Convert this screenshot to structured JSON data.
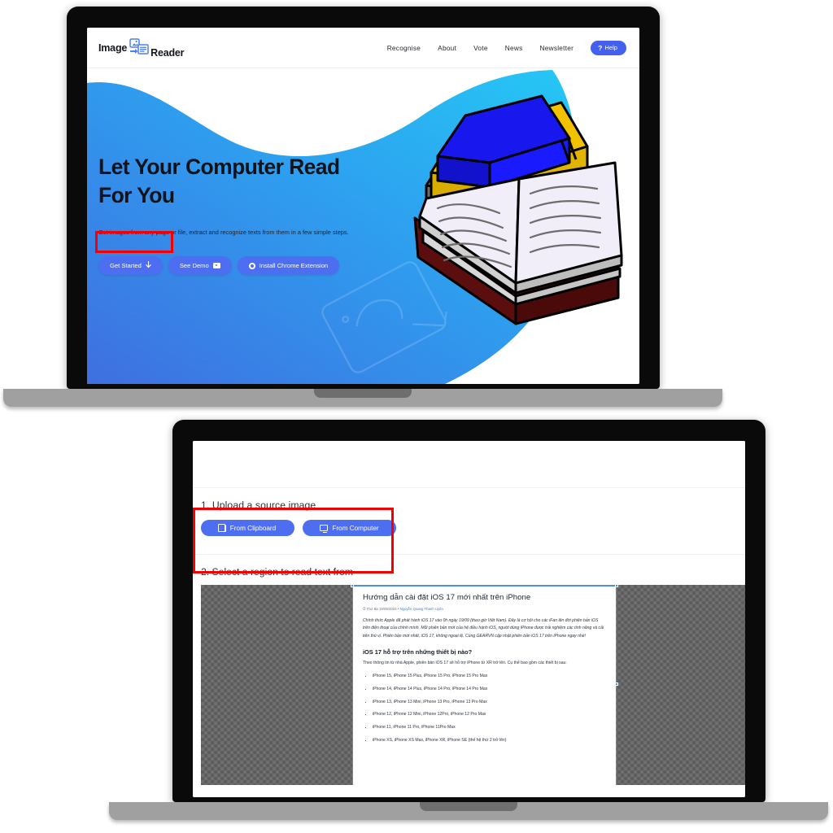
{
  "laptop1": {
    "header": {
      "brand_first": "Image",
      "brand_second": "Reader",
      "logo_icon": "image-to-document-icon",
      "nav": [
        {
          "label": "Recognise"
        },
        {
          "label": "About"
        },
        {
          "label": "Vote"
        },
        {
          "label": "News"
        },
        {
          "label": "Newsletter"
        }
      ],
      "help_button": {
        "mark": "?",
        "label": "Help"
      }
    },
    "hero": {
      "title": "Let Your Computer Read For You",
      "subtitle": "Get images from any page or file, extract and recognize texts from them in a few simple steps.",
      "buttons": {
        "get_started": "Get Started",
        "get_started_icon": "arrow-down-icon",
        "see_demo": "See Demo",
        "see_demo_icon": "youtube-play-icon",
        "install_extension": "Install Chrome Extension",
        "install_icon": "chrome-icon"
      },
      "illustration": "stack-of-books-illustration",
      "highlight_color": "#f50000",
      "gradient_from": "#3f6fe0",
      "gradient_to": "#29c2f2"
    }
  },
  "laptop2": {
    "step1": {
      "title": "1. Upload a source image",
      "buttons": {
        "clipboard": "From Clipboard",
        "clipboard_icon": "clipboard-icon",
        "computer": "From Computer",
        "computer_icon": "monitor-icon"
      },
      "highlight_color": "#f50000"
    },
    "step2": {
      "title": "2. Select a region to read text from",
      "selection_color": "#4a90e2",
      "document": {
        "heading": "Hướng dẫn cài đặt iOS 17 mới nhất trên iPhone",
        "meta_date": "Thứ Ba 19/09/2023",
        "meta_separator": "•",
        "meta_author": "Nguyễn Quang Thanh Uyên",
        "paragraph": "Chính thức Apple đã phát hành iOS 17 vào 0h ngày 19/09 (theo giờ Việt Nam). Đây là cơ hội cho các iFan lên đời phiên bản iOS trên điện thoại của chính mình. Mỗi phiên bản mới của hệ điều hành iOS, người dùng iPhone được trải nghiệm các tính năng và cải tiến thú vị. Phiên bản mới nhất, iOS 17, không ngoại lệ. Cùng GEARVN cập nhật phiên bản iOS 17 trên iPhone ngay nhé!",
        "subheading": "iOS 17 hỗ trợ trên những thiết bị nào?",
        "paragraph2": "Theo thông tin từ nhà Apple, phiên bản iOS 17 sẽ hỗ trợ iPhone từ XR trở lên. Cụ thể bao gồm các thiết bị sau:",
        "list": [
          "iPhone 15, iPhone 15 Plus, iPhone 15 Pro, iPhone 15 Pro Max",
          "iPhone 14, iPhone 14 Plus, iPhone 14 Pro, iPhone 14 Pro Max",
          "iPhone 13, iPhone 13 Mini, iPhone 13 Pro, iPhone 13 Pro Max",
          "iPhone 12, iPhone 12 Mini, iPhone 12Pro, iPhone 12 Pro Max",
          "iPhone 11, iPhone 11 Pro, iPhone 11Pro Max",
          "iPhone XS, iPhone XS Max, iPhone XR, iPhone SE (thế hệ thứ 2 trở lên)"
        ]
      }
    }
  }
}
